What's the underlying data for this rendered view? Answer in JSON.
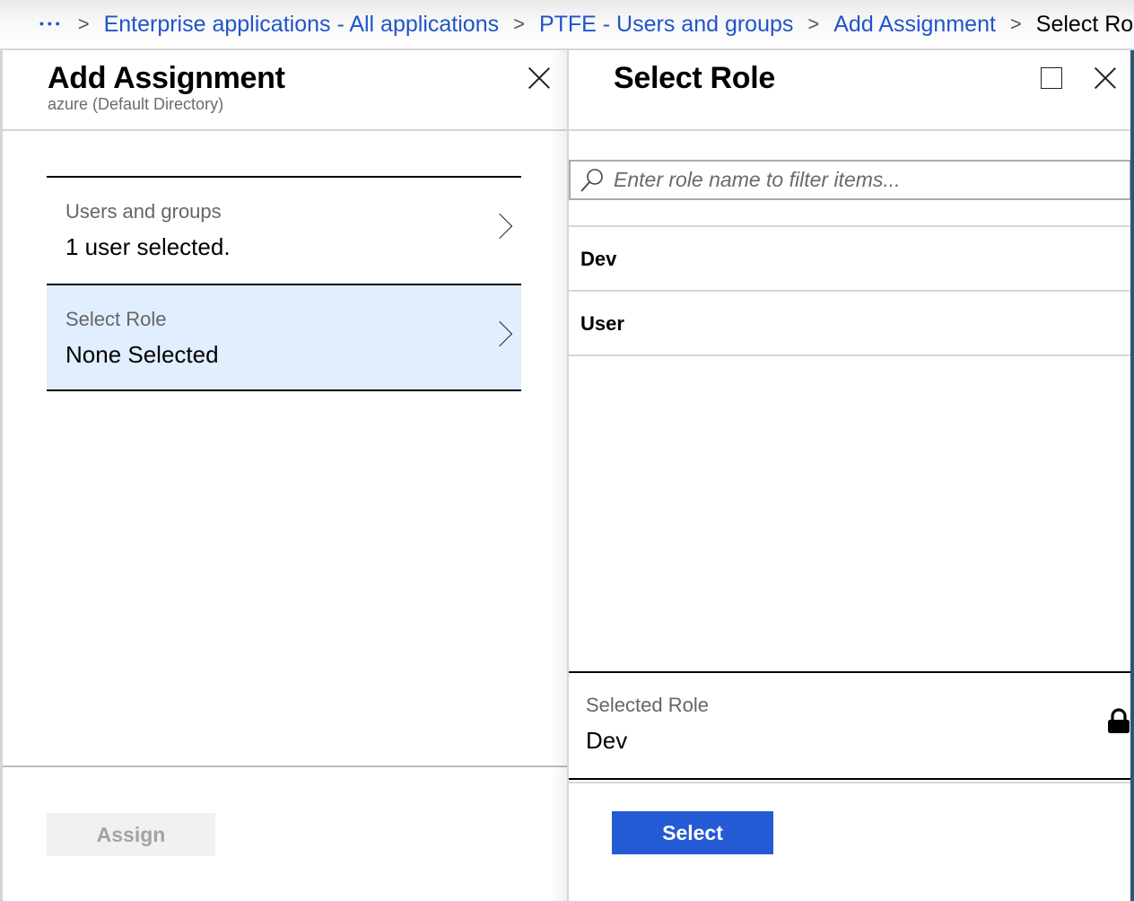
{
  "breadcrumb": {
    "ellipsis": "...",
    "items": [
      {
        "label": "Enterprise applications - All applications",
        "link": true
      },
      {
        "label": "PTFE - Users and groups",
        "link": true
      },
      {
        "label": "Add Assignment",
        "link": true
      },
      {
        "label": "Select Role",
        "link": false
      }
    ]
  },
  "add_assignment": {
    "title": "Add Assignment",
    "subtitle": "azure (Default Directory)",
    "fields": [
      {
        "label": "Users and groups",
        "value": "1 user selected.",
        "selected": false
      },
      {
        "label": "Select Role",
        "value": "None Selected",
        "selected": true
      }
    ],
    "assign_label": "Assign",
    "assign_enabled": false
  },
  "select_role": {
    "title": "Select Role",
    "search": {
      "placeholder": "Enter role name to filter items...",
      "value": ""
    },
    "roles": [
      "Dev",
      "User"
    ],
    "selected_role_label": "Selected Role",
    "selected_role_value": "Dev",
    "select_label": "Select"
  },
  "colors": {
    "link": "#2154c8",
    "primary_button": "#245bd4",
    "selected_row": "#e1eefd",
    "disabled_button": "#f1f1f1"
  }
}
